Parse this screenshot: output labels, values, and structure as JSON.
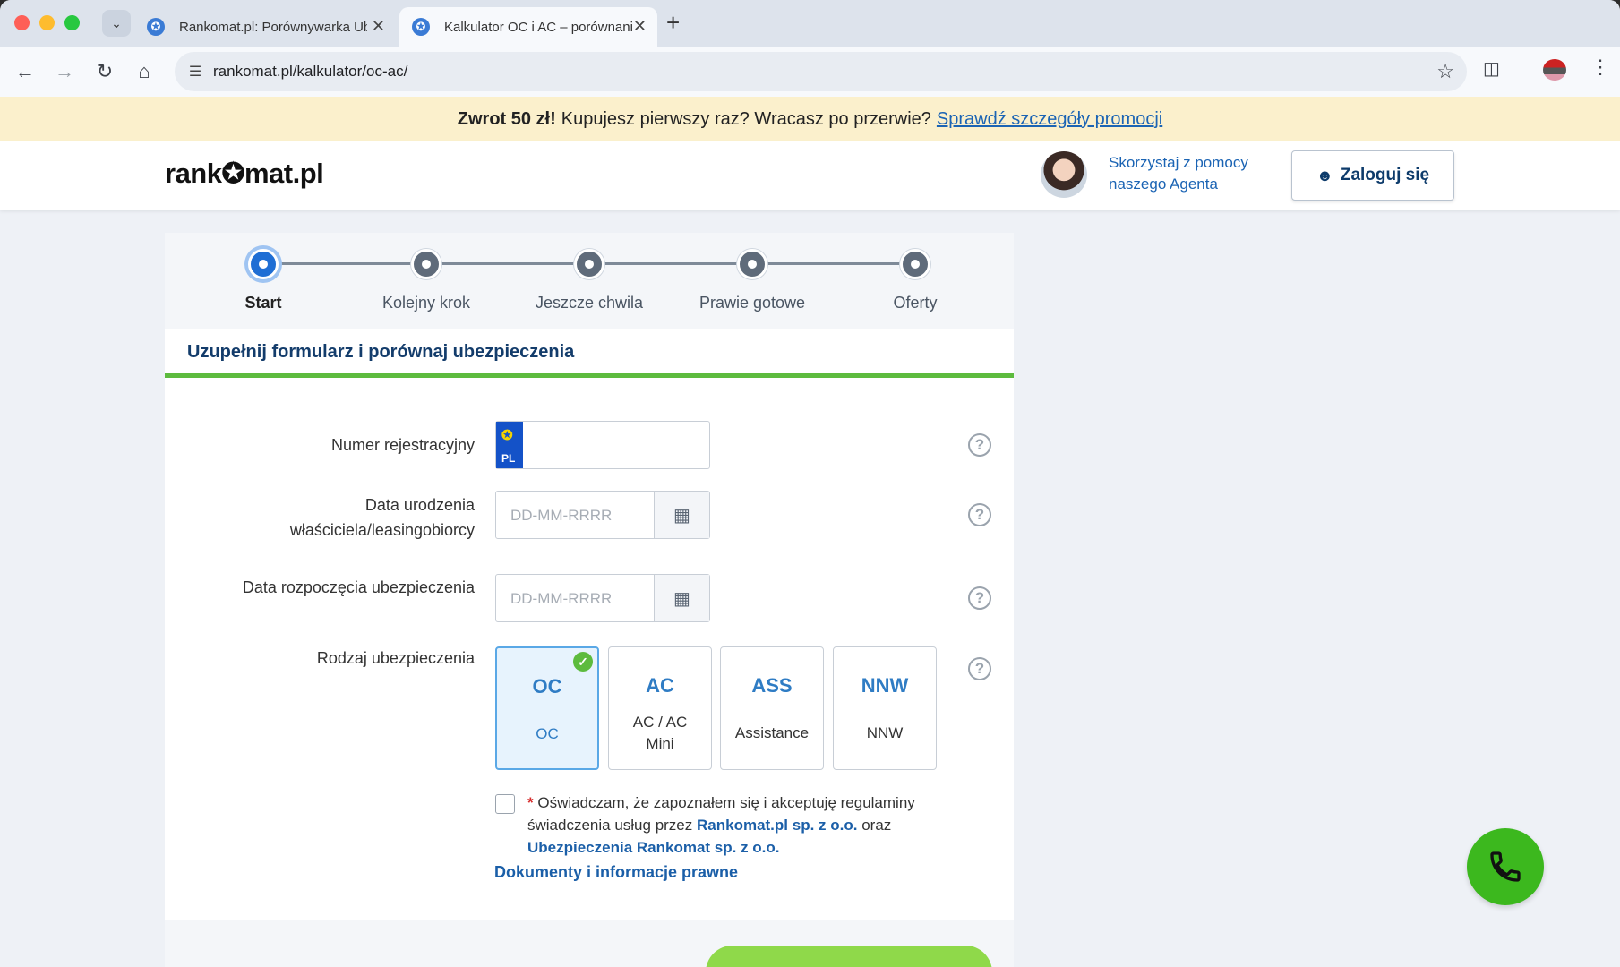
{
  "browser": {
    "tabs": [
      {
        "title": "Rankomat.pl: Porównywarka Ubezpieczeń"
      },
      {
        "title": "Kalkulator OC i AC – porównanie"
      }
    ],
    "url": "rankomat.pl/kalkulator/oc-ac/"
  },
  "promo": {
    "bold": "Zwrot 50 zł!",
    "text": "Kupujesz pierwszy raz? Wracasz po przerwie?",
    "link": "Sprawdź szczegóły promocji"
  },
  "header": {
    "logo": "rank✪mat.pl",
    "agent_text": "Skorzystaj z pomocy naszego Agenta",
    "login_label": "Zaloguj się"
  },
  "steps": [
    {
      "label": "Start",
      "active": true
    },
    {
      "label": "Kolejny krok"
    },
    {
      "label": "Jeszcze chwila"
    },
    {
      "label": "Prawie gotowe"
    },
    {
      "label": "Oferty"
    }
  ],
  "form": {
    "title": "Uzupełnij formularz i porównaj ubezpieczenia",
    "plate_label": "Numer rejestracyjny",
    "plate_country": "PL",
    "plate_value": "",
    "birth_label": "Data urodzenia właściciela/leasingobiorcy",
    "birth_placeholder": "DD-MM-RRRR",
    "start_label": "Data rozpoczęcia ubezpieczenia",
    "start_placeholder": "DD-MM-RRRR",
    "type_label": "Rodzaj ubezpieczenia",
    "types": [
      {
        "code": "OC",
        "name": "OC",
        "selected": true
      },
      {
        "code": "AC",
        "name": "AC / AC Mini"
      },
      {
        "code": "ASS",
        "name": "Assistance"
      },
      {
        "code": "NNW",
        "name": "NNW"
      }
    ],
    "consent": {
      "required_mark": "*",
      "text1": "Oświadczam, że zapoznałem się i akceptuję regulaminy świadczenia usług przez",
      "link1": "Rankomat.pl sp. z o.o.",
      "text2": "oraz",
      "link2": "Ubezpieczenia Rankomat sp. z o.o."
    },
    "docs_link": "Dokumenty i informacje prawne"
  },
  "help_symbol": "?"
}
